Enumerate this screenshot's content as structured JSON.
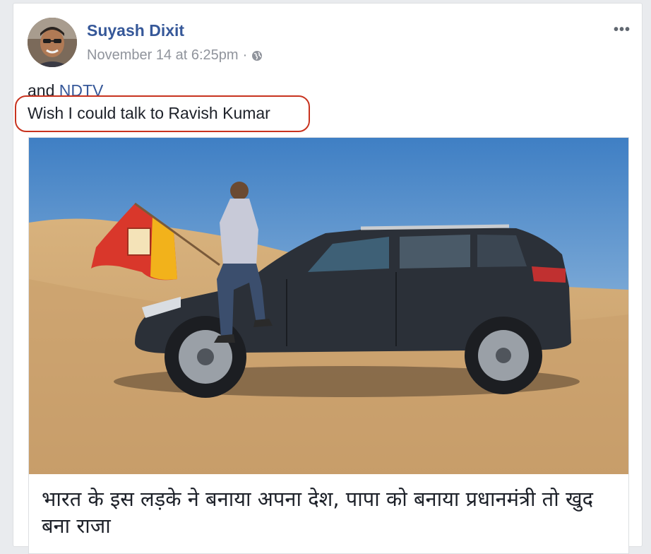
{
  "post": {
    "author": "Suyash Dixit",
    "timestamp": "November 14 at 6:25pm",
    "separator": "·",
    "privacy_icon": "globe-icon",
    "more_label": "•••",
    "text_prefix": "and ",
    "text_link": "NDTV",
    "text_line2": "Wish I could talk to Ravish Kumar"
  },
  "link_preview": {
    "headline": "भारत के इस लड़के ने बनाया अपना देश, पापा को बनाया प्रधानमंत्री तो खुद बना राजा"
  },
  "colors": {
    "link_blue": "#365899",
    "highlight_red": "#c8331f",
    "meta_gray": "#90949c"
  }
}
